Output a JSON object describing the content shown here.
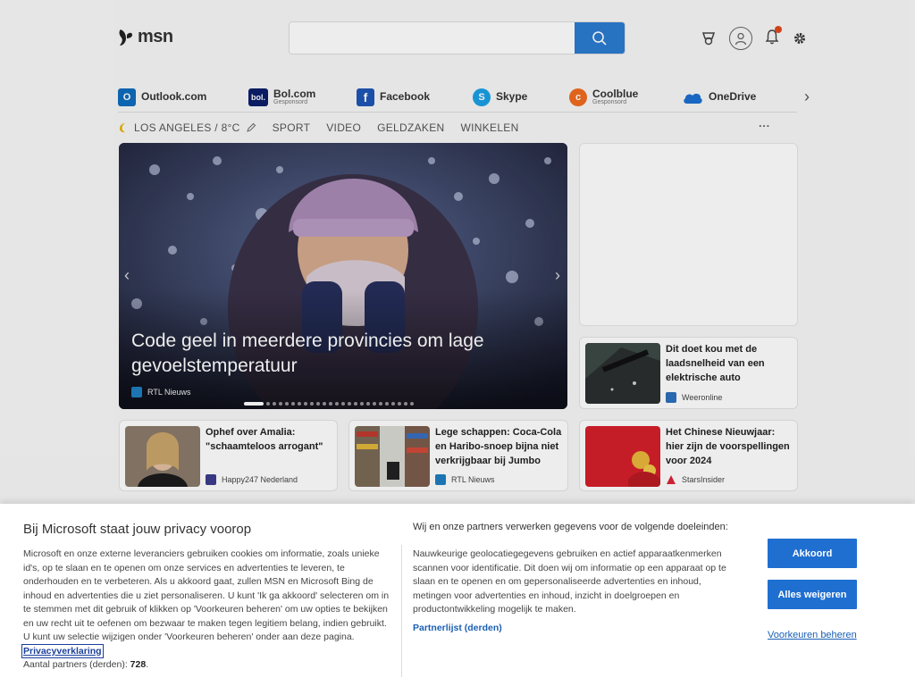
{
  "header": {
    "logo_text": "msn",
    "search_placeholder": ""
  },
  "quick_links": [
    {
      "label": "Outlook.com",
      "sub": "",
      "icon": "outlook-icon",
      "color": "#0f6cbd",
      "glyph": "O"
    },
    {
      "label": "Bol.com",
      "sub": "Gesponsord",
      "icon": "bol-icon",
      "color": "#0b1f6a",
      "glyph": "bol."
    },
    {
      "label": "Facebook",
      "sub": "",
      "icon": "facebook-icon",
      "color": "#1f56b5",
      "glyph": "f"
    },
    {
      "label": "Skype",
      "sub": "",
      "icon": "skype-icon",
      "color": "#1aa0e6",
      "glyph": "S"
    },
    {
      "label": "Coolblue",
      "sub": "Gesponsord",
      "icon": "coolblue-icon",
      "color": "#f06b1f",
      "glyph": "c"
    },
    {
      "label": "OneDrive",
      "sub": "",
      "icon": "onedrive-icon",
      "color": "#1b6fd1",
      "glyph": ""
    }
  ],
  "nav": {
    "location": "LOS ANGELES / 8°C",
    "items": [
      "SPORT",
      "VIDEO",
      "GELDZAKEN",
      "WINKELEN"
    ],
    "more": "···"
  },
  "hero": {
    "title": "Code geel in meerdere provincies om lage gevoelstemperatuur",
    "source": "RTL Nieuws"
  },
  "side_card": {
    "title": "Dit doet kou met de laadsnelheid van een elektrische auto",
    "source": "Weeronline"
  },
  "cards": [
    {
      "title": "Ophef over Amalia: \"schaamteloos arrogant\"",
      "source": "Happy247 Nederland"
    },
    {
      "title": "Lege schappen: Coca-Cola en Haribo-snoep bijna niet verkrijgbaar bij Jumbo",
      "source": "RTL Nieuws"
    },
    {
      "title": "Het Chinese Nieuwjaar: hier zijn de voorspellingen voor 2024",
      "source": "StarsInsider"
    }
  ],
  "consent": {
    "title": "Bij Microsoft staat jouw privacy voorop",
    "body": "Microsoft en onze externe leveranciers gebruiken cookies om informatie, zoals unieke id's, op te slaan en te openen om onze services en advertenties te leveren, te onderhouden en te verbeteren. Als u akkoord gaat, zullen MSN en Microsoft Bing de inhoud en advertenties die u ziet personaliseren. U kunt 'Ik ga akkoord' selecteren om in te stemmen met dit gebruik of klikken op 'Voorkeuren beheren' om uw opties te bekijken en uw recht uit te oefenen om bezwaar te maken tegen legitiem belang, indien gebruikt. U kunt uw selectie wijzigen onder 'Voorkeuren beheren' onder aan deze pagina.",
    "privacy_link": "Privacyverklaring",
    "partners_label": "Aantal partners (derden):",
    "partners_count": "728",
    "mid_title": "Wij en onze partners verwerken gegevens voor de volgende doeleinden:",
    "mid_body": "Nauwkeurige geolocatiegegevens gebruiken en actief apparaatkenmerken scannen voor identificatie. Dit doen wij om informatie op een apparaat op te slaan en te openen en om gepersonaliseerde advertenties en inhoud, metingen voor advertenties en inhoud, inzicht in doelgroepen en productontwikkeling mogelijk te maken.",
    "partner_list_link": "Partnerlijst (derden)",
    "accept_label": "Akkoord",
    "reject_label": "Alles weigeren",
    "prefs_label": "Voorkeuren beheren"
  }
}
